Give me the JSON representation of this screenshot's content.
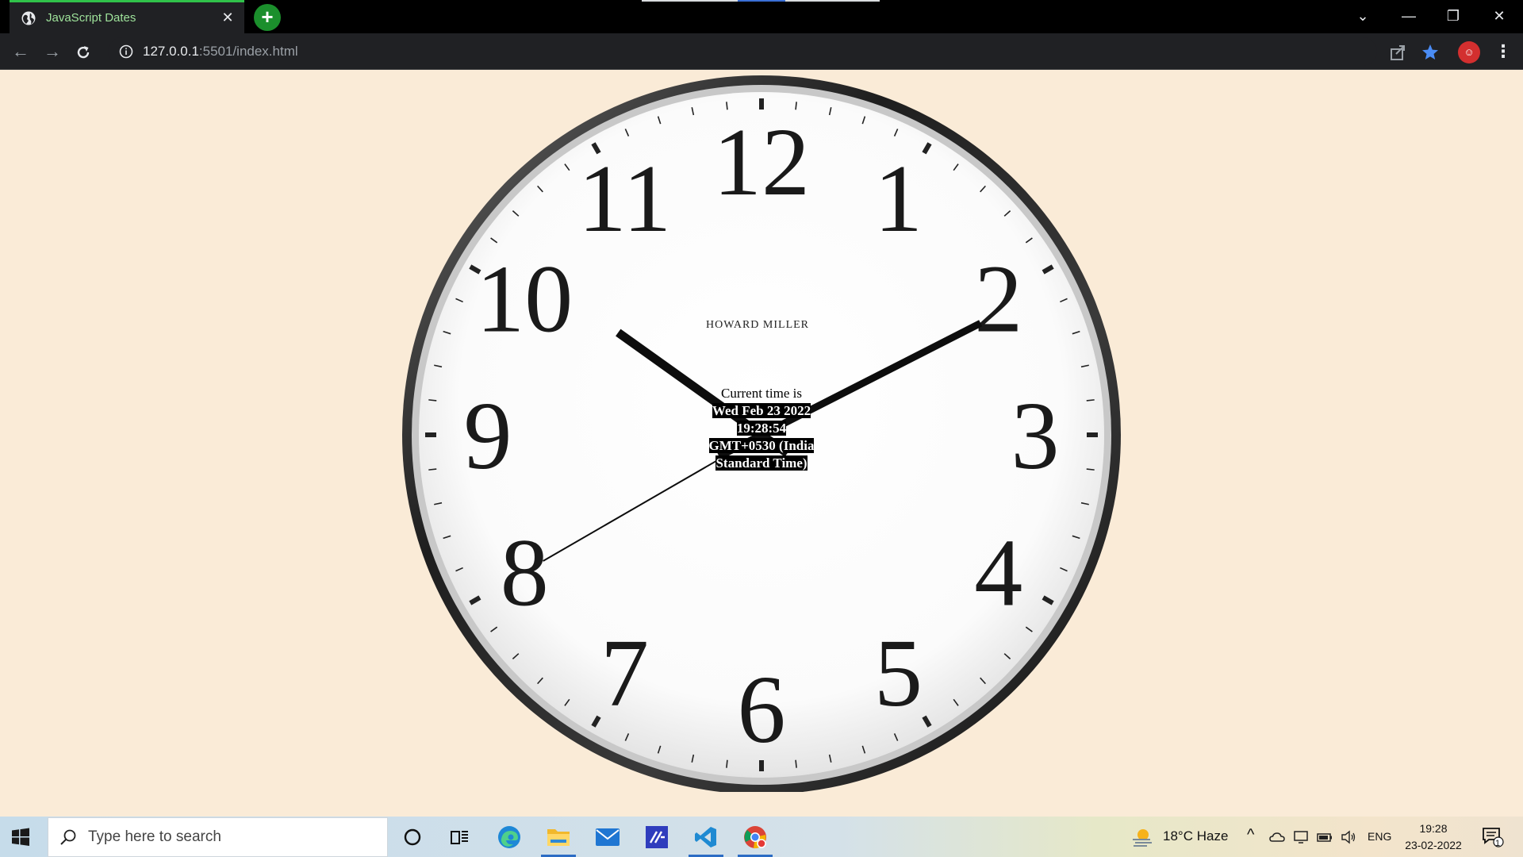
{
  "browser": {
    "tab_title": "JavaScript Dates",
    "url_host": "127.0.0.1",
    "url_path": ":5501/index.html",
    "accent": "#30c24a"
  },
  "page": {
    "background": "#faebd7",
    "clock": {
      "brand": "HOWARD MILLER",
      "numerals": [
        "12",
        "1",
        "2",
        "3",
        "4",
        "5",
        "6",
        "7",
        "8",
        "9",
        "10",
        "11"
      ],
      "hands": {
        "hour": "10:11",
        "minute": 10.5,
        "second": 40
      }
    },
    "time_label": "Current time is",
    "time_value": "Wed Feb 23 2022 19:28:54 GMT+0530 (India Standard Time)"
  },
  "taskbar": {
    "search_placeholder": "Type here to search",
    "weather": "18°C  Haze",
    "language": "ENG",
    "time": "19:28",
    "date": "23-02-2022",
    "notification_count": "1",
    "apps": [
      "cortana-icon",
      "task-view-icon",
      "edge-icon",
      "file-explorer-icon",
      "mail-icon",
      "visual-studio-icon",
      "vscode-icon",
      "chrome-icon"
    ]
  }
}
